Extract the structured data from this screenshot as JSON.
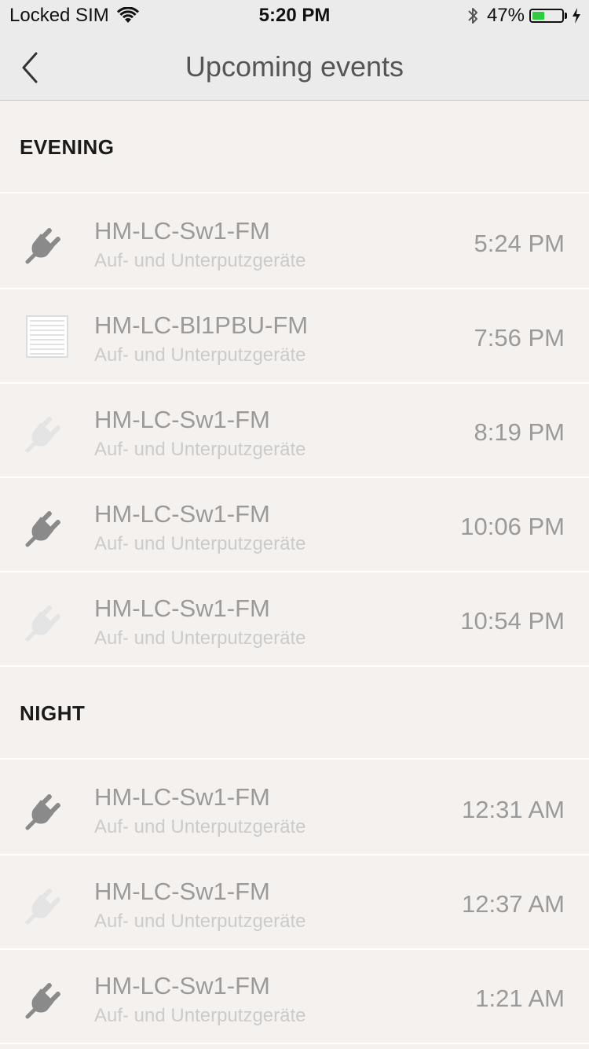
{
  "status_bar": {
    "carrier": "Locked SIM",
    "time": "5:20 PM",
    "battery_percent": "47%",
    "battery_level": 0.47,
    "battery_color": "#2ecc40"
  },
  "nav": {
    "back_icon": "chevron-left-icon",
    "title": "Upcoming events"
  },
  "sections": [
    {
      "title": "EVENING",
      "events": [
        {
          "name": "HM-LC-Sw1-FM",
          "category": "Auf- und Unterputzgeräte",
          "time": "5:24 PM",
          "icon": "plug-dark"
        },
        {
          "name": "HM-LC-Bl1PBU-FM",
          "category": "Auf- und Unterputzgeräte",
          "time": "7:56 PM",
          "icon": "blind"
        },
        {
          "name": "HM-LC-Sw1-FM",
          "category": "Auf- und Unterputzgeräte",
          "time": "8:19 PM",
          "icon": "plug-light"
        },
        {
          "name": "HM-LC-Sw1-FM",
          "category": "Auf- und Unterputzgeräte",
          "time": "10:06 PM",
          "icon": "plug-dark"
        },
        {
          "name": "HM-LC-Sw1-FM",
          "category": "Auf- und Unterputzgeräte",
          "time": "10:54 PM",
          "icon": "plug-light"
        }
      ]
    },
    {
      "title": "NIGHT",
      "events": [
        {
          "name": "HM-LC-Sw1-FM",
          "category": "Auf- und Unterputzgeräte",
          "time": "12:31 AM",
          "icon": "plug-dark"
        },
        {
          "name": "HM-LC-Sw1-FM",
          "category": "Auf- und Unterputzgeräte",
          "time": "12:37 AM",
          "icon": "plug-light"
        },
        {
          "name": "HM-LC-Sw1-FM",
          "category": "Auf- und Unterputzgeräte",
          "time": "1:21 AM",
          "icon": "plug-dark"
        }
      ]
    }
  ]
}
